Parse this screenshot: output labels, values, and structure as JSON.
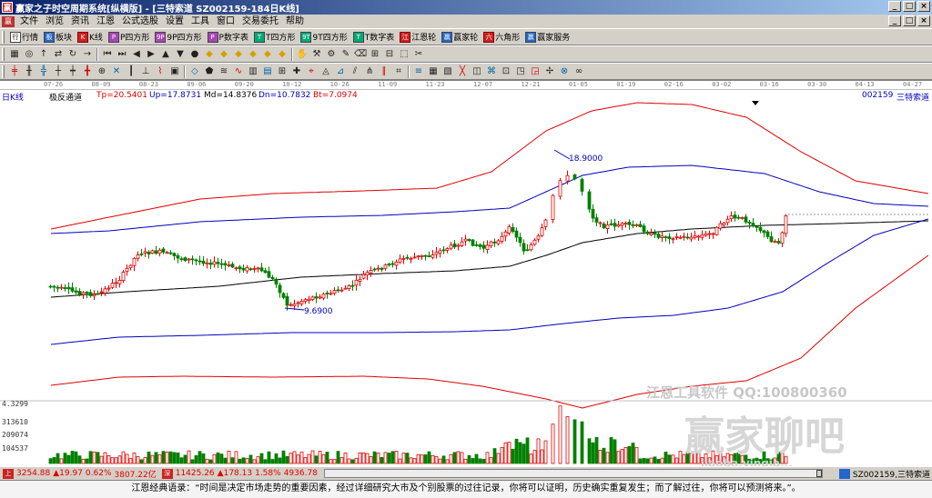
{
  "window": {
    "title": "赢家之子时空周期系统[纵横版] - [三特索道   SZ002159-184日K线]",
    "app_icon": "赢",
    "minimize": "_",
    "maximize": "□",
    "close": "×"
  },
  "menu": {
    "logo": "赢",
    "items": [
      "文件",
      "浏览",
      "资讯",
      "江恩",
      "公式选股",
      "设置",
      "工具",
      "窗口",
      "交易委托",
      "帮助"
    ]
  },
  "toolbar1": {
    "buttons": [
      {
        "icon": "行",
        "label": "行情"
      },
      {
        "icon": "板",
        "label": "板块"
      },
      {
        "icon": "K",
        "label": "K线"
      },
      {
        "icon": "P",
        "label": "P四方形"
      },
      {
        "icon": "9P",
        "label": "9P四方形"
      },
      {
        "icon": "P",
        "label": "P数字表"
      },
      {
        "icon": "T",
        "label": "T四方形"
      },
      {
        "icon": "9T",
        "label": "9T四方形"
      },
      {
        "icon": "T",
        "label": "T数字表"
      },
      {
        "icon": "江",
        "label": "江恩轮"
      },
      {
        "icon": "赢",
        "label": "赢家轮"
      },
      {
        "icon": "六",
        "label": "六角形"
      },
      {
        "icon": "赢",
        "label": "赢家服务"
      }
    ]
  },
  "toolbar2": {
    "icons": [
      "grid-icon",
      "target-icon",
      "arrow-up-icon",
      "swap-icon",
      "cycle-icon",
      "arrow-right-icon",
      "go-first-icon",
      "go-last-icon",
      "back-icon",
      "play-icon",
      "triangle-up-icon",
      "triangle-down-icon",
      "circle-icon",
      "diamond-icon",
      "diamond-icon",
      "diamond-icon",
      "diamond-icon",
      "diamond-icon",
      "diamond-icon",
      "hand-icon",
      "tool-icon",
      "tool-icon",
      "tool-icon",
      "tool-icon",
      "tool-icon",
      "tool-icon",
      "tool-icon",
      "tool-icon"
    ],
    "glyphs": [
      "▦",
      "◎",
      "↑",
      "⇄",
      "↻",
      "→",
      "⏮",
      "⏭",
      "◀",
      "▶",
      "▲",
      "▼",
      "●",
      "◆",
      "◆",
      "◆",
      "◆",
      "◆",
      "◆",
      "✋",
      "⚒",
      "⚙",
      "✎",
      "⌫",
      "⊞",
      "⊟",
      "⬚",
      "✂"
    ]
  },
  "toolbar3": {
    "glyphs": [
      "╪",
      "╫",
      "╬",
      "┼",
      "┿",
      "╋",
      "⊕",
      "✕",
      "┃",
      "⊥",
      "⌇",
      "▣",
      "◇",
      "⬟",
      "≋",
      "∿",
      "▥",
      "▤",
      "⊞",
      "✚",
      "⌖",
      "◬",
      "⊿",
      "⫽",
      "⋔",
      "∥",
      "⌗",
      "≡",
      "▦",
      "▧",
      "╳",
      "◫",
      "⌘",
      "⊡",
      "◳",
      "◲",
      "✢",
      "⊗",
      "∞"
    ]
  },
  "chart": {
    "period_label": "日K线",
    "indicator_name": "极反通道",
    "tp": "Tp=20.5401",
    "up": "Up=17.8731",
    "md": "Md=14.8376",
    "dn": "Dn=10.7832",
    "bt": "Bt=7.0974",
    "stock_code": "002159",
    "stock_name": "三特索道",
    "high_label": "18.9000",
    "low_label": "9.6900",
    "volume_axis": [
      "4.3299",
      "313610",
      "209074",
      "104537"
    ],
    "date_ticks": [
      "07-26",
      "08-09",
      "08-23",
      "09-06",
      "09-20",
      "10-12",
      "10-26",
      "11-09",
      "11-23",
      "12-07",
      "12-21",
      "01-05",
      "01-19",
      "02-16",
      "03-02",
      "03-16",
      "03-30",
      "04-13",
      "04-27"
    ],
    "watermark_main": "赢家聊吧",
    "watermark_tool": "江恩工具软件 QQ:100800360",
    "watermark_url": "jiaoba.yingja..."
  },
  "chart_data": {
    "type": "candlestick",
    "series": [
      {
        "name": "Tp",
        "value": 20.5401
      },
      {
        "name": "Up",
        "value": 17.8731
      },
      {
        "name": "Md",
        "value": 14.8376
      },
      {
        "name": "Dn",
        "value": 10.7832
      },
      {
        "name": "Bt",
        "value": 7.0974
      }
    ],
    "high": 18.9,
    "low": 9.69,
    "volume_ticks": [
      313610,
      209074,
      104537
    ],
    "colors": {
      "up": "#e00000",
      "down": "#008000",
      "outer_band": "#e00000",
      "inner_band": "#0000c0",
      "mid": "#000000"
    }
  },
  "status": {
    "sh_index": "3254.88",
    "sh_change": "▲19.97",
    "sh_pct": "0.62%",
    "sh_amount": "3807.22亿",
    "sz_index": "11425.26",
    "sz_change": "▲178.13",
    "sz_pct": "1.58%",
    "sz_amount": "4936.78",
    "right_label": "SZ002159,三特索道"
  },
  "quote": "江恩经典语录：“时间是决定市场走势的重要因素，经过详细研究大市及个别股票的过往记录，你将可以证明，历史确实重复发生；而了解过往，你将可以预测将来。”。"
}
